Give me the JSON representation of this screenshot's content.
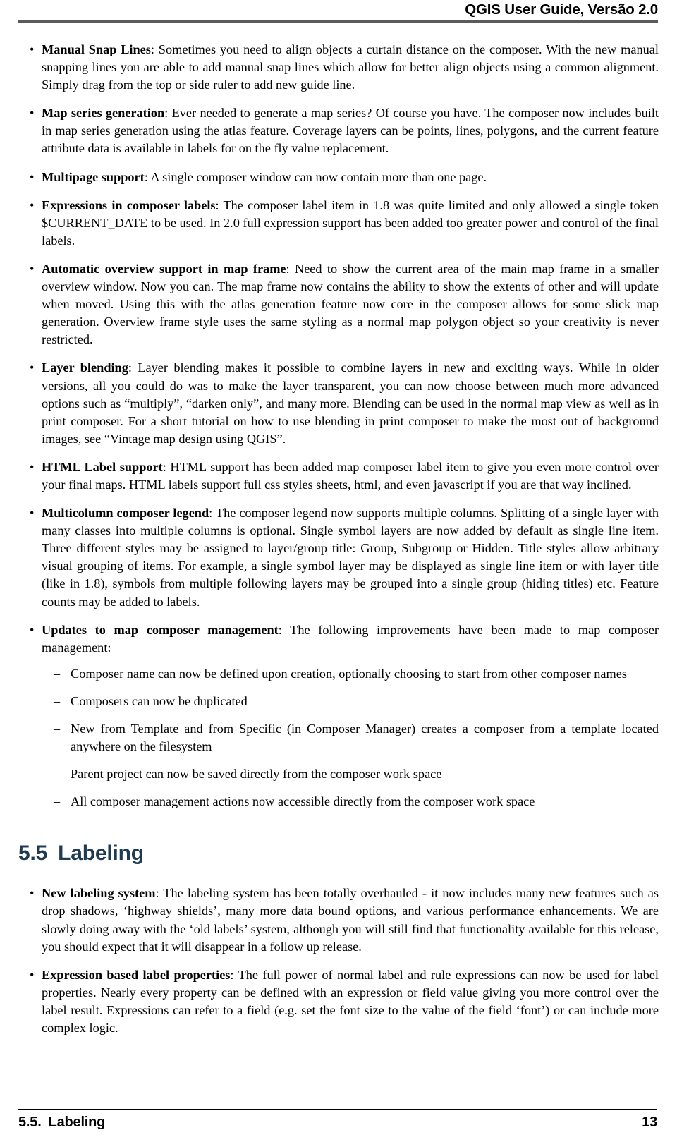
{
  "header": {
    "title": "QGIS User Guide, Versão 2.0"
  },
  "footer": {
    "section_number": "5.5.",
    "section_title": "Labeling",
    "page_number": "13"
  },
  "section": {
    "number": "5.5",
    "title": "Labeling"
  },
  "bullet_glyph": "•",
  "dash_glyph": "–",
  "composer_bullets": [
    {
      "term": "Manual Snap Lines",
      "text": ": Sometimes you need to align objects a curtain distance on the composer. With the new manual snapping lines you are able to add manual snap lines which allow for better align objects using a common alignment. Simply drag from the top or side ruler to add new guide line."
    },
    {
      "term": "Map series generation",
      "text": ": Ever needed to generate a map series? Of course you have. The composer now includes built in map series generation using the atlas feature. Coverage layers can be points, lines, polygons, and the current feature attribute data is available in labels for on the fly value replacement."
    },
    {
      "term": "Multipage support",
      "text": ": A single composer window can now contain more than one page."
    },
    {
      "term": "Expressions in composer labels",
      "text": ": The composer label item in 1.8 was quite limited and only allowed a single token $CURRENT_DATE to be used. In 2.0 full expression support has been added too greater power and control of the final labels."
    },
    {
      "term": "Automatic overview support in map frame",
      "text": ": Need to show the current area of the main map frame in a smaller overview window. Now you can. The map frame now contains the ability to show the extents of other and will update when moved. Using this with the atlas generation feature now core in the composer allows for some slick map generation. Overview frame style uses the same styling as a normal map polygon object so your creativity is never restricted."
    },
    {
      "term": "Layer blending",
      "text": ": Layer blending makes it possible to combine layers in new and exciting ways. While in older versions, all you could do was to make the layer transparent, you can now choose between much more advanced options such as “multiply”, “darken only”, and many more. Blending can be used in the normal map view as well as in print composer. For a short tutorial on how to use blending in print composer to make the most out of background images, see “Vintage map design using QGIS”."
    },
    {
      "term": "HTML Label support",
      "text": ": HTML support has been added map composer label item to give you even more control over your final maps. HTML labels support full css styles sheets, html, and even javascript if you are that way inclined."
    },
    {
      "term": "Multicolumn composer legend",
      "text": ": The composer legend now supports multiple columns. Splitting of a single layer with many classes into multiple columns is optional. Single symbol layers are now added by default as single line item. Three different styles may be assigned to layer/group title: Group, Subgroup or Hidden. Title styles allow arbitrary visual grouping of items. For example, a single symbol layer may be displayed as single line item or with layer title (like in 1.8), symbols from multiple following layers may be grouped into a single group (hiding titles) etc. Feature counts may be added to labels."
    }
  ],
  "management_bullet": {
    "term": "Updates to map composer management",
    "text": ": The following improvements have been made to map composer management:",
    "sub_items": [
      "Composer name can now be defined upon creation, optionally choosing to start from other composer names",
      "Composers can now be duplicated",
      "New from Template and from Specific (in Composer Manager) creates a composer from a template located anywhere on the filesystem",
      "Parent project can now be saved directly from the composer work space",
      "All composer management actions now accessible directly from the composer work space"
    ]
  },
  "labeling_bullets": [
    {
      "term": "New labeling system",
      "text": ": The labeling system has been totally overhauled - it now includes many new features such as drop shadows, ‘highway shields’, many more data bound options, and various performance enhancements. We are slowly doing away with the ‘old labels’ system, although you will still find that functionality available for this release, you should expect that it will disappear in a follow up release."
    },
    {
      "term": "Expression based label properties",
      "text": ": The full power of normal label and rule expressions can now be used for label properties. Nearly every property can be defined with an expression or field value giving you more control over the label result. Expressions can refer to a field (e.g. set the font size to the value of the field ‘font’) or can include more complex logic."
    }
  ],
  "colors": {
    "heading": "#1f3b52",
    "header_rule": "#5b5b5b",
    "footer_rule": "#000000",
    "text": "#000000"
  }
}
